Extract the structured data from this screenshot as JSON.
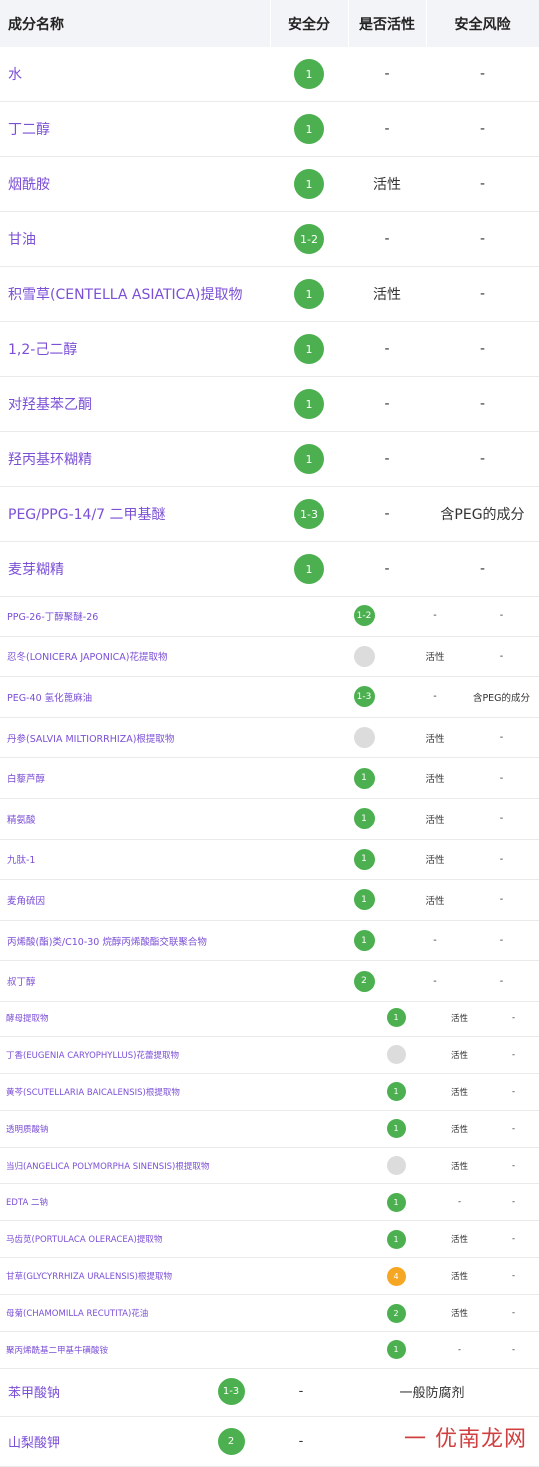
{
  "header": {
    "name": "成分名称",
    "score": "安全分",
    "active": "是否活性",
    "risk": "安全风险"
  },
  "section1": [
    {
      "name": "水",
      "score": "1",
      "color": "green",
      "active": "-",
      "risk": "-"
    },
    {
      "name": "丁二醇",
      "score": "1",
      "color": "green",
      "active": "-",
      "risk": "-"
    },
    {
      "name": "烟酰胺",
      "score": "1",
      "color": "green",
      "active": "活性",
      "risk": "-"
    },
    {
      "name": "甘油",
      "score": "1-2",
      "color": "green",
      "active": "-",
      "risk": "-"
    },
    {
      "name": "积雪草(CENTELLA ASIATICA)提取物",
      "score": "1",
      "color": "green",
      "active": "活性",
      "risk": "-"
    },
    {
      "name": "1,2-己二醇",
      "score": "1",
      "color": "green",
      "active": "-",
      "risk": "-"
    },
    {
      "name": "对羟基苯乙酮",
      "score": "1",
      "color": "green",
      "active": "-",
      "risk": "-"
    },
    {
      "name": "羟丙基环糊精",
      "score": "1",
      "color": "green",
      "active": "-",
      "risk": "-"
    },
    {
      "name": "PEG/PPG-14/7 二甲基醚",
      "score": "1-3",
      "color": "green",
      "active": "-",
      "risk": "含PEG的成分"
    },
    {
      "name": "麦芽糊精",
      "score": "1",
      "color": "green",
      "active": "-",
      "risk": "-"
    }
  ],
  "section2": [
    {
      "name": "PPG-26-丁醇聚醚-26",
      "score": "1-2",
      "color": "green",
      "active": "-",
      "risk": "-"
    },
    {
      "name": "忍冬(LONICERA JAPONICA)花提取物",
      "score": "",
      "color": "gray",
      "active": "活性",
      "risk": "-"
    },
    {
      "name": "PEG-40 氢化蓖麻油",
      "score": "1-3",
      "color": "green",
      "active": "-",
      "risk": "含PEG的成分"
    },
    {
      "name": "丹参(SALVIA MILTIORRHIZA)根提取物",
      "score": "",
      "color": "gray",
      "active": "活性",
      "risk": "-"
    },
    {
      "name": "白藜芦醇",
      "score": "1",
      "color": "green",
      "active": "活性",
      "risk": "-"
    },
    {
      "name": "精氨酸",
      "score": "1",
      "color": "green",
      "active": "活性",
      "risk": "-"
    },
    {
      "name": "九肽-1",
      "score": "1",
      "color": "green",
      "active": "活性",
      "risk": "-"
    },
    {
      "name": "麦角硫因",
      "score": "1",
      "color": "green",
      "active": "活性",
      "risk": "-"
    },
    {
      "name": "丙烯酸(酯)类/C10-30 烷醇丙烯酸酯交联聚合物",
      "score": "1",
      "color": "green",
      "active": "-",
      "risk": "-"
    },
    {
      "name": "叔丁醇",
      "score": "2",
      "color": "green",
      "active": "-",
      "risk": "-"
    }
  ],
  "section3": [
    {
      "name": "酵母提取物",
      "score": "1",
      "color": "green",
      "active": "活性",
      "risk": "-"
    },
    {
      "name": "丁香(EUGENIA CARYOPHYLLUS)花蕾提取物",
      "score": "",
      "color": "gray",
      "active": "活性",
      "risk": "-"
    },
    {
      "name": "黄芩(SCUTELLARIA BAICALENSIS)根提取物",
      "score": "1",
      "color": "green",
      "active": "活性",
      "risk": "-"
    },
    {
      "name": "透明质酸钠",
      "score": "1",
      "color": "green",
      "active": "活性",
      "risk": "-"
    },
    {
      "name": "当归(ANGELICA POLYMORPHA SINENSIS)根提取物",
      "score": "",
      "color": "gray",
      "active": "活性",
      "risk": "-"
    },
    {
      "name": "EDTA 二钠",
      "score": "1",
      "color": "green",
      "active": "-",
      "risk": "-"
    },
    {
      "name": "马齿苋(PORTULACA OLERACEA)提取物",
      "score": "1",
      "color": "green",
      "active": "活性",
      "risk": "-"
    },
    {
      "name": "甘草(GLYCYRRHIZA URALENSIS)根提取物",
      "score": "4",
      "color": "orange",
      "active": "活性",
      "risk": "-"
    },
    {
      "name": "母菊(CHAMOMILLA RECUTITA)花油",
      "score": "2",
      "color": "green",
      "active": "活性",
      "risk": "-"
    },
    {
      "name": "聚丙烯酰基二甲基牛磺酸铵",
      "score": "1",
      "color": "green",
      "active": "-",
      "risk": "-"
    }
  ],
  "section4": [
    {
      "name": "苯甲酸钠",
      "score": "1-3",
      "color": "green",
      "active": "-",
      "risk": "一般防腐剂"
    },
    {
      "name": "山梨酸钾",
      "score": "2",
      "color": "green",
      "active": "-",
      "risk": ""
    }
  ],
  "watermark": "一 优南龙网"
}
